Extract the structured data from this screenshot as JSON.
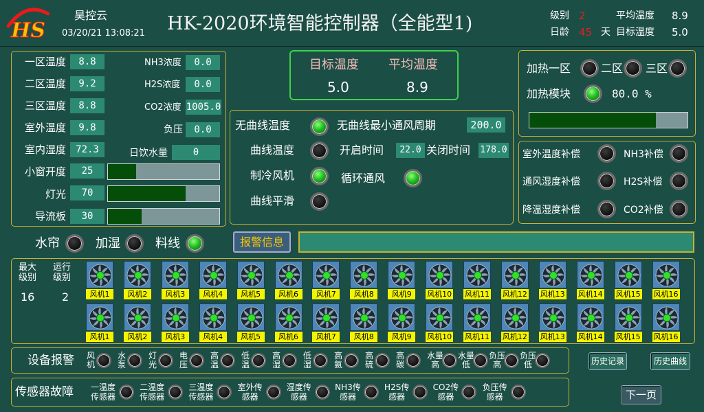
{
  "header": {
    "logo_text": "HS",
    "company": "昊控云",
    "datetime": "03/20/21 13:08:21",
    "title": "HK-2020环境智能控制器（全能型1)",
    "level_label": "级别",
    "level_value": "2",
    "age_label": "日龄",
    "age_value": "45",
    "age_unit": "天",
    "avg_temp_label": "平均温度",
    "avg_temp_value": "8.9",
    "target_temp_label": "目标温度",
    "target_temp_value": "5.0"
  },
  "readings": {
    "zone1_label": "一区温度",
    "zone1_value": "8.8",
    "zone2_label": "二区温度",
    "zone2_value": "9.2",
    "zone3_label": "三区温度",
    "zone3_value": "8.8",
    "outdoor_label": "室外温度",
    "outdoor_value": "9.8",
    "humidity_label": "室内湿度",
    "humidity_value": "72.3",
    "nh3_label": "NH3浓度",
    "nh3_value": "0.0",
    "h2s_label": "H2S浓度",
    "h2s_value": "0.0",
    "co2_label": "CO2浓度",
    "co2_value": "1005.0",
    "pressure_label": "负压",
    "pressure_value": "0.0",
    "water_label": "日饮水量",
    "water_value": "0",
    "window_label": "小窗开度",
    "window_value": "25",
    "light_label": "灯光",
    "light_value": "70",
    "baffle_label": "导流板",
    "baffle_value": "30",
    "window_fraction": 0.25,
    "light_fraction": 0.7,
    "baffle_fraction": 0.3
  },
  "target_box": {
    "target_label": "目标温度",
    "target_value": "5.0",
    "avg_label": "平均温度",
    "avg_value": "8.9"
  },
  "modes": {
    "no_curve_label": "无曲线温度",
    "curve_label": "曲线温度",
    "cooling_fan_label": "制冷风机",
    "curve_smooth_label": "曲线平滑",
    "min_period_label": "无曲线最小通风周期",
    "min_period_value": "200.0",
    "on_time_label": "开启时间",
    "on_time_value": "22.0",
    "off_time_label": "关闭时间",
    "off_time_value": "178.0",
    "circulation_label": "循环通风"
  },
  "heating": {
    "zone1_label": "加热一区",
    "zone2_label": "二区",
    "zone3_label": "三区",
    "module_label": "加热模块",
    "module_value": "80.0 %",
    "module_fraction": 0.8
  },
  "compensation": {
    "outdoor_temp": "室外温度补偿",
    "nh3": "NH3补偿",
    "vent_humidity": "通风湿度补偿",
    "h2s": "H2S补偿",
    "cool_humidity": "降温湿度补偿",
    "co2": "CO2补偿"
  },
  "toggles": {
    "curtain": "水帘",
    "humidify": "加湿",
    "feedline": "料线"
  },
  "alarm": {
    "button": "报警信息",
    "message": ""
  },
  "fans": {
    "max_level_label": "最大级别",
    "max_level_value": "16",
    "run_level_label": "运行级别",
    "run_level_value": "2",
    "names": [
      "风机1",
      "风机2",
      "风机3",
      "风机4",
      "风机5",
      "风机6",
      "风机7",
      "风机8",
      "风机9",
      "风机10",
      "风机11",
      "风机12",
      "风机13",
      "风机14",
      "风机15",
      "风机16"
    ]
  },
  "device_alarm": {
    "title": "设备报警",
    "items": [
      "风机",
      "水泵",
      "灯光",
      "电压",
      "高温",
      "低温",
      "高湿",
      "低湿",
      "高氨",
      "高硫",
      "高碳",
      "水量高",
      "水量低",
      "负压高",
      "负压低"
    ]
  },
  "sensor_fault": {
    "title": "传感器故障",
    "items": [
      "一温度传感器",
      "二温度传感器",
      "三温度传感器",
      "室外传感器",
      "湿度传感器",
      "NH3传感器",
      "H2S传感器",
      "CO2传感器",
      "负压传感器"
    ]
  },
  "buttons": {
    "history_record": "历史记录",
    "history_curve": "历史曲线",
    "next_page": "下一页"
  },
  "colors": {
    "background": "#1b4e45",
    "value_box": "#2d8a72",
    "border": "#c9b233",
    "led_on": "#1fba21",
    "fan_tag": "#f4f400",
    "accent_red": "#e02020"
  }
}
